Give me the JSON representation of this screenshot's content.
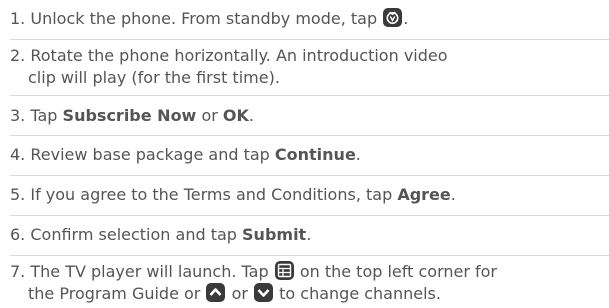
{
  "steps": [
    {
      "num": "1.",
      "pre": "Unlock the phone. From standby mode, tap",
      "post": "."
    },
    {
      "num": "2.",
      "line1": "Rotate the phone horizontally. An introduction video",
      "line2": "clip will play (for the first time)."
    },
    {
      "num": "3.",
      "pre": "Tap",
      "bold1": "Subscribe Now",
      "mid": "or",
      "bold2": "OK",
      "post": "."
    },
    {
      "num": "4.",
      "pre": "Review base package and tap",
      "bold": "Continue",
      "post": "."
    },
    {
      "num": "5.",
      "pre": "If you agree to the Terms and Conditions, tap",
      "bold": "Agree",
      "post": "."
    },
    {
      "num": "6.",
      "pre": "Confirm selection and tap",
      "bold": "Submit",
      "post": "."
    },
    {
      "num": "7.",
      "pre": "The TV player will launch. Tap",
      "post": "on the top left corner for",
      "line2_pre": "the Program Guide or",
      "line2_mid": "or",
      "line2_post": "to change channels."
    }
  ],
  "icons": [
    "tv-app-icon",
    "program-guide-icon",
    "channel-up-icon",
    "channel-down-icon"
  ]
}
